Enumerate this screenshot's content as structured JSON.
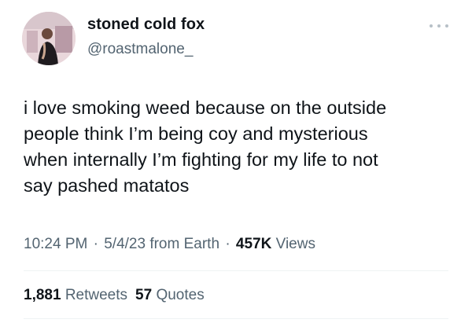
{
  "user": {
    "display_name": "stoned cold fox",
    "handle": "@roastmalone_"
  },
  "tweet": {
    "lines": [
      "i love smoking weed because on the outside",
      "people think I’m being coy and mysterious",
      "when internally I’m fighting for my life to not",
      "say pashed matatos"
    ]
  },
  "meta": {
    "time": "10:24 PM",
    "separator": "·",
    "date": "5/4/23",
    "source": "from Earth",
    "views_count": "457K",
    "views_label": "Views"
  },
  "stats": {
    "retweets_count": "1,881",
    "retweets_label": "Retweets",
    "quotes_count": "57",
    "quotes_label": "Quotes"
  },
  "icons": {
    "more": "more-options-icon"
  },
  "colors": {
    "text_primary": "#0f1419",
    "text_secondary": "#536471",
    "divider": "#eff3f4"
  }
}
